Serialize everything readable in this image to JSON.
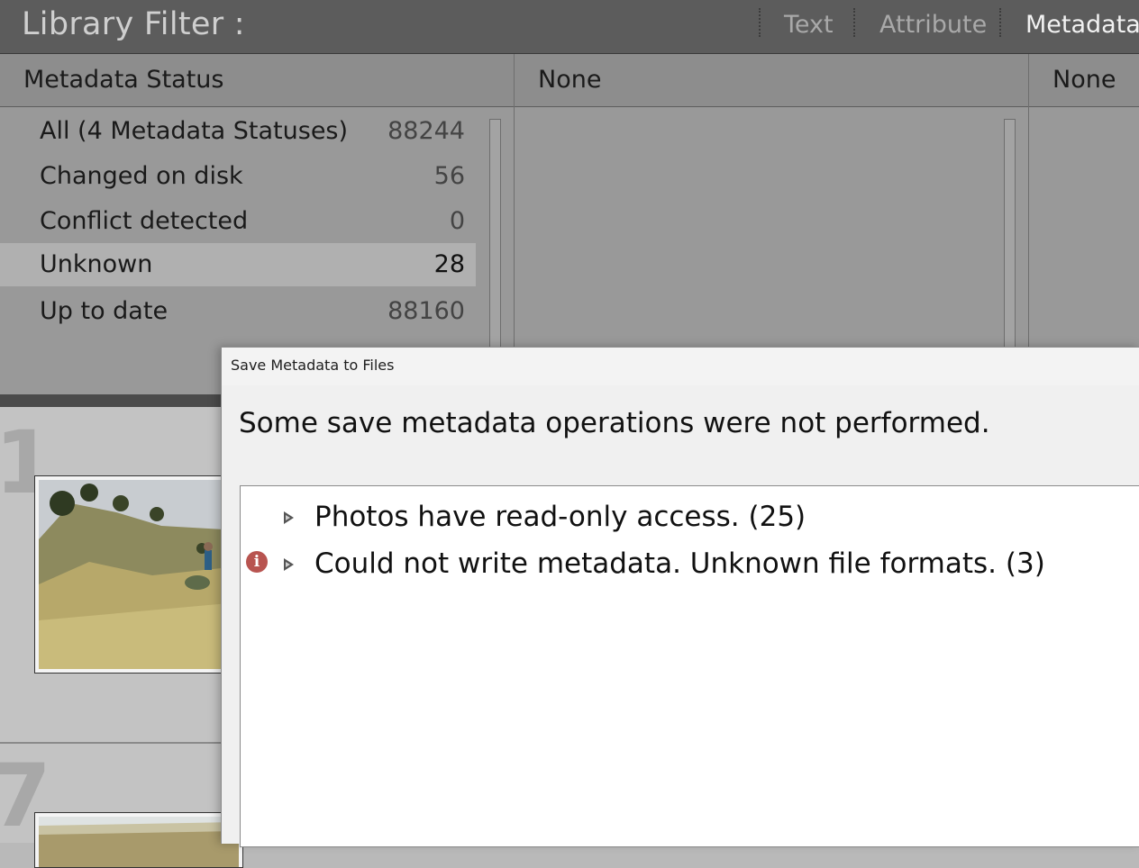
{
  "filter_bar": {
    "title": "Library Filter :",
    "tabs": [
      {
        "label": "Text",
        "active": false
      },
      {
        "label": "Attribute",
        "active": false
      },
      {
        "label": "Metadata",
        "active": true
      }
    ]
  },
  "columns": [
    {
      "header": "Metadata Status",
      "rows": [
        {
          "label": "All (4 Metadata Statuses)",
          "count": "88244",
          "selected": false
        },
        {
          "label": "Changed on disk",
          "count": "56",
          "selected": false
        },
        {
          "label": "Conflict detected",
          "count": "0",
          "selected": false
        },
        {
          "label": "Unknown",
          "count": "28",
          "selected": true
        },
        {
          "label": "Up to date",
          "count": "88160",
          "selected": false
        }
      ]
    },
    {
      "header": "None",
      "rows": []
    },
    {
      "header": "None",
      "rows": []
    }
  ],
  "grid": {
    "cell_indices": [
      "1",
      "7"
    ]
  },
  "dialog": {
    "title": "Save Metadata to Files",
    "message": "Some save metadata operations were not performed.",
    "issues": [
      {
        "text": "Photos have read-only access. (25)",
        "icon": null
      },
      {
        "text": "Could not write metadata. Unknown file formats. (3)",
        "icon": "error-info-icon"
      }
    ]
  },
  "colors": {
    "filter_bar_bg": "#5c5c5c",
    "panel_bg": "#999999",
    "selected_row_bg": "#b0b0b0",
    "error_icon": "#b85450"
  }
}
